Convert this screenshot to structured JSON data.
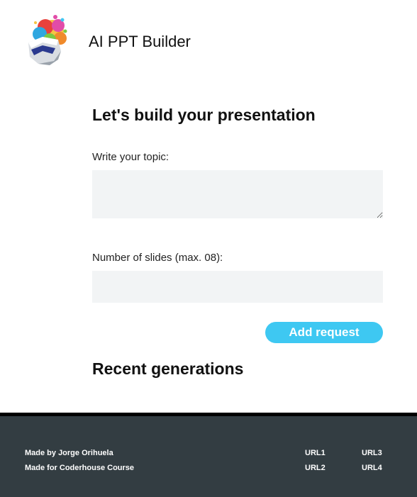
{
  "header": {
    "app_title": "AI PPT Builder",
    "logo_icon": "colorful-robot-helmet-logo"
  },
  "form": {
    "heading": "Let's build your presentation",
    "topic_label": "Write your topic:",
    "topic_value": "",
    "slides_label": "Number of slides (max. 08):",
    "slides_value": "",
    "submit_label": "Add request",
    "accent_color": "#3ec8f2",
    "input_bg_color": "#f2f4f5"
  },
  "recent": {
    "heading": "Recent generations"
  },
  "footer": {
    "made_by": "Made by Jorge Orihuela",
    "made_for": "Made for Coderhouse Course",
    "links": [
      "URL1",
      "URL2",
      "URL3",
      "URL4"
    ],
    "background_color": "#333d42"
  }
}
